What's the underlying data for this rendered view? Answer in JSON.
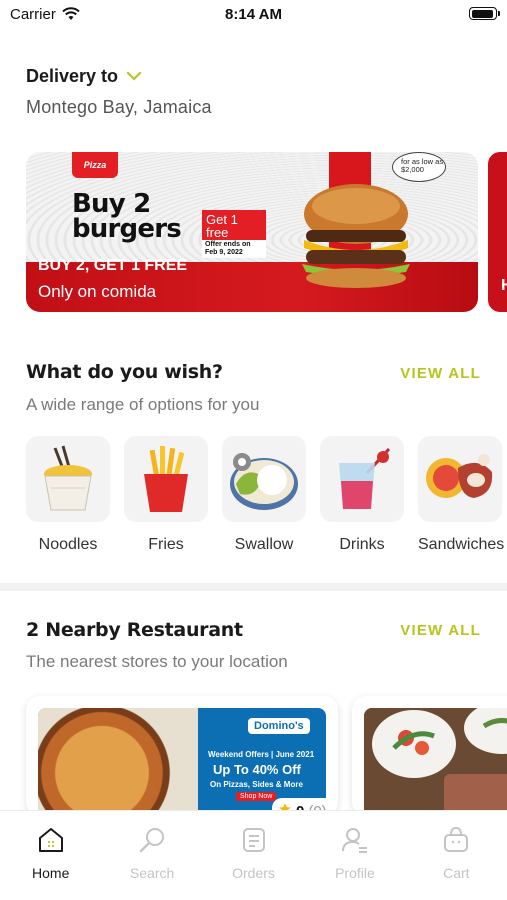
{
  "status_bar": {
    "carrier": "Carrier",
    "time": "8:14 AM",
    "battery_level": 0.95
  },
  "delivery": {
    "label": "Delivery to",
    "location": "Montego Bay, Jamaica"
  },
  "banner": {
    "logo_text": "Pizza",
    "headline_line1": "Buy 2",
    "headline_line2": "burgers",
    "get_free": "Get 1 free",
    "offer_ends": "Offer ends on Feb 9, 2022",
    "price_badge": "for as low as $2,000",
    "promo_title": "BUY 2, GET 1 FREE",
    "promo_sub": "Only on comida",
    "peek_letter": "H"
  },
  "categories_section": {
    "title": "What do you wish?",
    "subtitle": "A wide range of options for you",
    "view_all": "VIEW ALL",
    "items": [
      {
        "label": "Noodles",
        "icon": "noodles-icon"
      },
      {
        "label": "Fries",
        "icon": "fries-icon"
      },
      {
        "label": "Swallow",
        "icon": "swallow-icon"
      },
      {
        "label": "Drinks",
        "icon": "drinks-icon"
      },
      {
        "label": "Sandwiches",
        "icon": "sandwiches-icon"
      }
    ]
  },
  "nearby_section": {
    "title": "2 Nearby Restaurant",
    "subtitle": "The nearest stores to your location",
    "view_all": "VIEW ALL",
    "restaurant": {
      "brand": "Domino's",
      "offer_small": "Weekend Offers | June 2021",
      "offer_big": "Up To 40% Off",
      "offer_detail": "On Pizzas, Sides & More",
      "shop_now": "Shop Now",
      "rating": "0",
      "rating_count": "(0)"
    }
  },
  "tab_bar": {
    "items": [
      {
        "label": "Home",
        "icon": "home-icon",
        "active": true
      },
      {
        "label": "Search",
        "icon": "search-icon",
        "active": false
      },
      {
        "label": "Orders",
        "icon": "orders-icon",
        "active": false
      },
      {
        "label": "Profile",
        "icon": "profile-icon",
        "active": false
      },
      {
        "label": "Cart",
        "icon": "cart-icon",
        "active": false
      }
    ]
  },
  "colors": {
    "accent": "#B6C51E",
    "promo_red": "#D51A1F",
    "text_dark": "#1A1A1A",
    "text_muted": "#7A7A7A"
  }
}
